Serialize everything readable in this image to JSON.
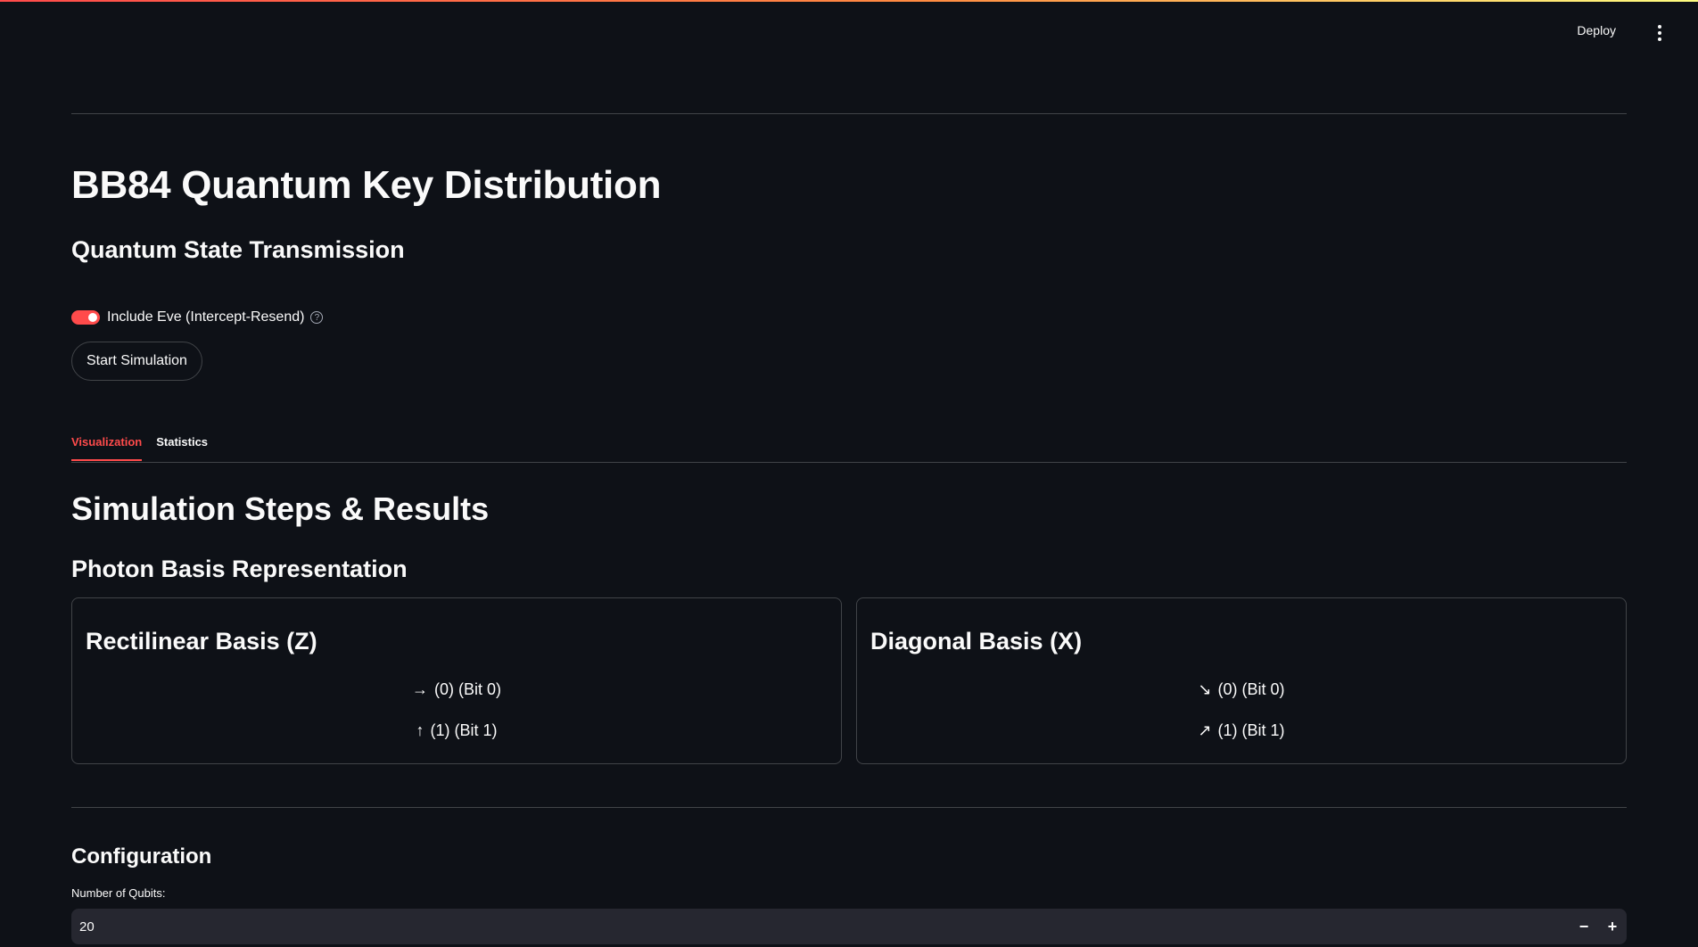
{
  "header": {
    "deploy_label": "Deploy",
    "menu_icon": "vertical-ellipsis-icon"
  },
  "page": {
    "title": "BB84 Quantum Key Distribution",
    "subtitle": "Quantum State Transmission"
  },
  "controls": {
    "eve_toggle_label": "Include Eve (Intercept-Resend)",
    "eve_toggle_on": true,
    "help_icon": "question-circle-icon",
    "start_button_label": "Start Simulation"
  },
  "tabs": [
    {
      "label": "Visualization",
      "active": true
    },
    {
      "label": "Statistics",
      "active": false
    }
  ],
  "results": {
    "heading": "Simulation Steps & Results",
    "photon_heading": "Photon Basis Representation",
    "rectilinear": {
      "title": "Rectilinear Basis (Z)",
      "bit0_arrow": "→",
      "bit0_text": "(0) (Bit 0)",
      "bit1_arrow": "↑",
      "bit1_text": "(1) (Bit 1)"
    },
    "diagonal": {
      "title": "Diagonal Basis (X)",
      "bit0_arrow": "↘",
      "bit0_text": "(0) (Bit 0)",
      "bit1_arrow": "↗",
      "bit1_text": "(1) (Bit 1)"
    }
  },
  "configuration": {
    "title": "Configuration",
    "qubits_label": "Number of Qubits:",
    "qubits_value": "20",
    "decrement_label": "−",
    "increment_label": "+"
  },
  "colors": {
    "background": "#0e1117",
    "accent": "#ff4b4b",
    "input_background": "#262730",
    "text": "#fafafa"
  }
}
